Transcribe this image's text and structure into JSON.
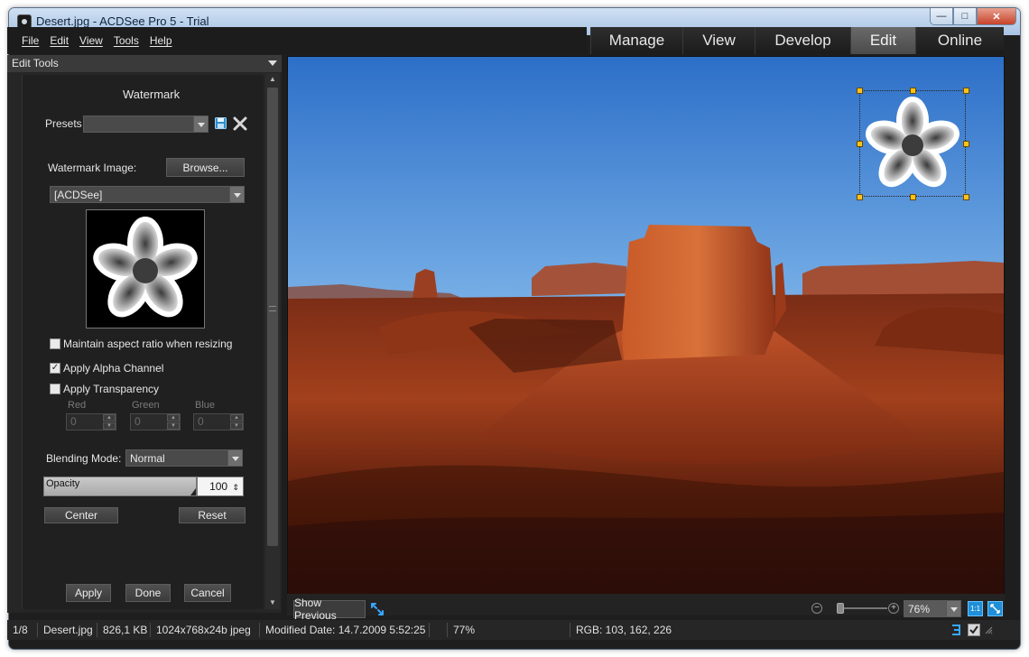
{
  "window": {
    "title": "Desert.jpg - ACDSee Pro 5 - Trial"
  },
  "menu": [
    "File",
    "Edit",
    "View",
    "Tools",
    "Help"
  ],
  "modes": [
    {
      "label": "Manage",
      "active": false
    },
    {
      "label": "View",
      "active": false
    },
    {
      "label": "Develop",
      "active": false
    },
    {
      "label": "Edit",
      "active": true
    },
    {
      "label": "Online",
      "active": false
    }
  ],
  "panel": {
    "header": "Edit Tools",
    "title": "Watermark",
    "presets_label": "Presets",
    "presets_value": "",
    "watermark_image_label": "Watermark Image:",
    "browse_label": "Browse...",
    "image_source": "[ACDSee]",
    "maintain_aspect": {
      "label": "Maintain aspect ratio when resizing",
      "checked": false
    },
    "apply_alpha": {
      "label": "Apply Alpha Channel",
      "checked": true
    },
    "apply_transparency": {
      "label": "Apply Transparency",
      "checked": false
    },
    "rgb_labels": {
      "red": "Red",
      "green": "Green",
      "blue": "Blue"
    },
    "rgb_values": {
      "red": "0",
      "green": "0",
      "blue": "0"
    },
    "blending_label": "Blending Mode:",
    "blending_value": "Normal",
    "opacity_label": "Opacity",
    "opacity_value": "100",
    "opacity_fraction": 1.0,
    "center_label": "Center",
    "reset_label": "Reset",
    "apply_label": "Apply",
    "done_label": "Done",
    "cancel_label": "Cancel"
  },
  "viewer": {
    "show_previous": "Show Previous",
    "zoom_value": "76%",
    "one_to_one": "1:1"
  },
  "status": {
    "position": "1/8",
    "filename": "Desert.jpg",
    "filesize": "826,1 KB",
    "dimensions": "1024x768x24b jpeg",
    "modified": "Modified Date: 14.7.2009 5:52:25",
    "zoom": "77%",
    "rgb": "RGB: 103, 162, 226"
  },
  "colors": {
    "accent_blue": "#1e8fd8",
    "handle_yellow": "#ffc21a"
  }
}
